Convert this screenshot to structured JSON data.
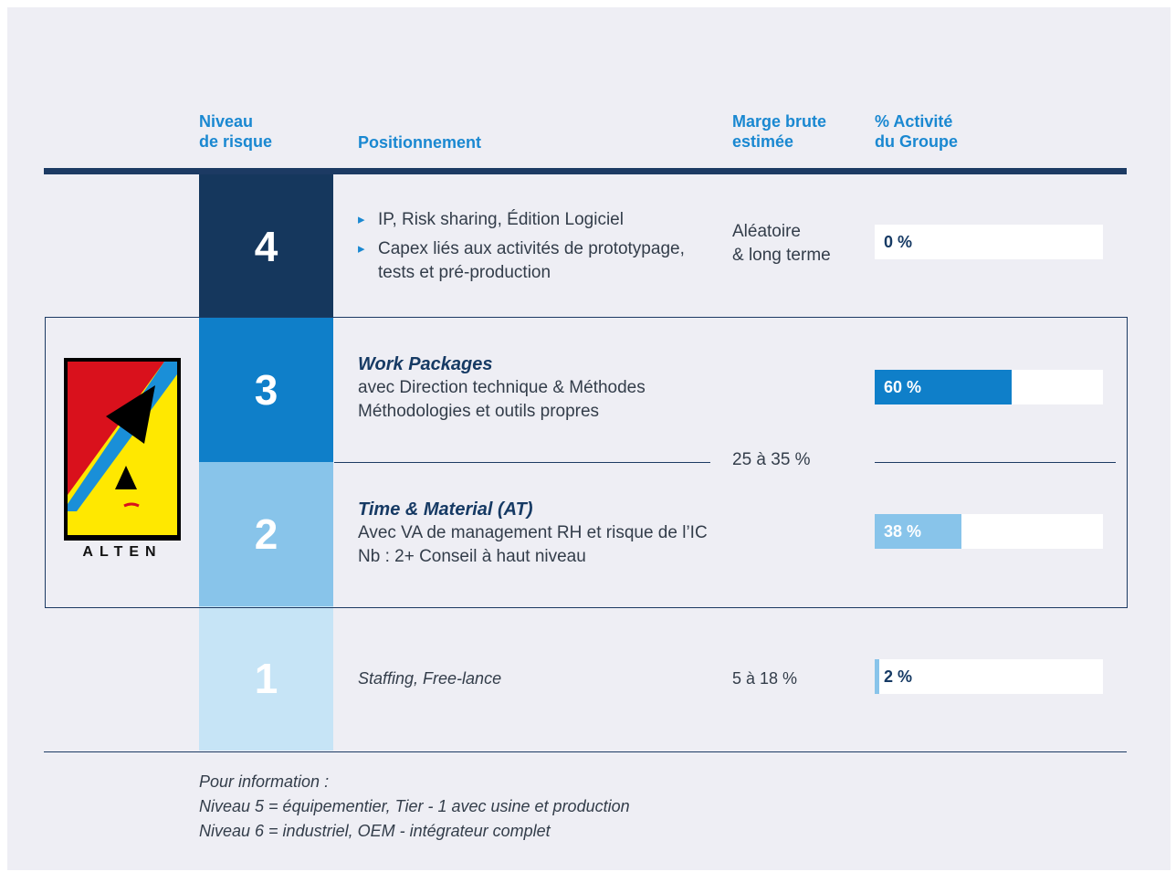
{
  "headers": {
    "risk_level": "Niveau\nde risque",
    "positioning": "Positionnement",
    "margin": "Marge brute\nestimée",
    "activity": "% Activité\ndu Groupe"
  },
  "logo": {
    "text": "ALTEN"
  },
  "rows": [
    {
      "level": "4",
      "color": "#15375d",
      "bullets": [
        "IP, Risk sharing, Édition Logiciel",
        "Capex liés aux activités de prototypage, tests et pré-production"
      ],
      "margin": "Aléatoire\n& long terme",
      "activity_label": "0 %",
      "activity_value": 0
    },
    {
      "level": "3",
      "color": "#0f7fc9",
      "title": "Work Packages",
      "lines": [
        "avec Direction technique & Méthodes",
        "Méthodologies et outils propres"
      ],
      "activity_label": "60 %",
      "activity_value": 60,
      "bar_color": "#0f7fc9"
    },
    {
      "level": "2",
      "color": "#88c4ea",
      "title": "Time & Material (AT)",
      "lines": [
        "Avec VA de management RH et risque de l’IC",
        "Nb : 2+ Conseil à haut niveau"
      ],
      "activity_label": "38 %",
      "activity_value": 38,
      "bar_color": "#88c4ea"
    },
    {
      "level": "1",
      "color": "#c6e4f6",
      "text": "Staffing, Free-lance",
      "margin": "5 à 18 %",
      "activity_label": "2 %",
      "activity_value": 2,
      "bar_color": "#88c4ea"
    }
  ],
  "shared_margin": "25 à 35 %",
  "note": {
    "l1": "Pour information :",
    "l2": "Niveau 5 = équipementier, Tier - 1 avec usine et production",
    "l3": "Niveau 6 = industriel, OEM - intégrateur complet"
  }
}
